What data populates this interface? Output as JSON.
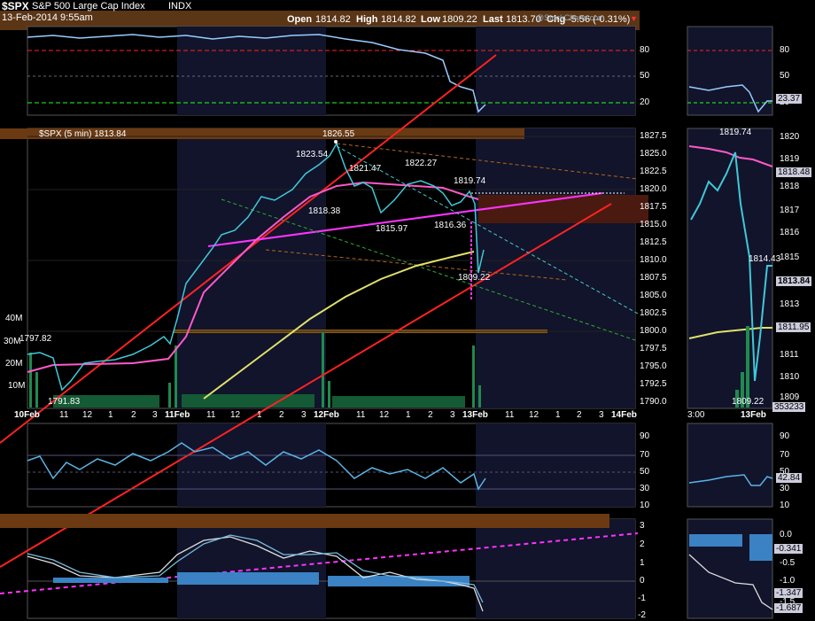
{
  "colors": {
    "bg": "#000000",
    "price": "#40c8d8",
    "ema_fast": "#ff59c7",
    "ema_slow": "#e1e16a",
    "trend": "#ff1c1c",
    "band": "#6b3a12",
    "volume": "#1f8a4f"
  },
  "header": {
    "symbol": "$SPX",
    "name": "S&P 500 Large Cap Index",
    "exchange": "INDX",
    "date": "13-Feb-2014 9:55am",
    "open_label": "Open",
    "open": "1814.82",
    "high_label": "High",
    "high": "1814.82",
    "low_label": "Low",
    "low": "1809.22",
    "last_label": "Last",
    "last": "1813.70",
    "chg_label": "Chg",
    "chg": "-5.56 (-0.31%)",
    "watermark": "@StockCharts.com"
  },
  "rsi_top": {
    "ticks": [
      "80",
      "50",
      "20"
    ]
  },
  "price_panel": {
    "legend": "$SPX (5 min) 1813.84",
    "ticks": [
      "1827.5",
      "1825.0",
      "1822.5",
      "1820.0",
      "1817.5",
      "1815.0",
      "1812.5",
      "1810.0",
      "1807.5",
      "1805.0",
      "1802.5",
      "1800.0",
      "1797.5",
      "1795.0",
      "1792.5",
      "1790.0"
    ],
    "annotations": [
      "1826.55",
      "1823.54",
      "1821.47",
      "1822.27",
      "1819.74",
      "1818.38",
      "1815.97",
      "1816.36",
      "1809.22",
      "1797.82",
      "1791.83"
    ],
    "vol_labels": [
      "40M",
      "30M",
      "20M",
      "10M"
    ]
  },
  "x_axis": {
    "labels": [
      "10Feb",
      "11",
      "12",
      "1",
      "2",
      "3",
      "11Feb",
      "11",
      "12",
      "1",
      "2",
      "3",
      "12Feb",
      "11",
      "12",
      "1",
      "2",
      "3",
      "13Feb",
      "11",
      "12",
      "1",
      "2",
      "3",
      "14Feb"
    ]
  },
  "rsi_panel": {
    "ticks": [
      "90",
      "70",
      "50",
      "30",
      "10"
    ]
  },
  "macd_panel": {
    "ticks": [
      "3",
      "2",
      "1",
      "0",
      "-1",
      "-2"
    ]
  },
  "right": {
    "rsi_ticks": [
      "80",
      "50",
      "20"
    ],
    "rsi_value": "23.37",
    "price_ticks": [
      "1820",
      "1819",
      "1818",
      "1817",
      "1816",
      "1815",
      "1814",
      "1813",
      "1812",
      "1811",
      "1810",
      "1809"
    ],
    "price_labels": {
      "high": "1819.74",
      "ema": "1818.48",
      "peak": "1814.43",
      "last": "1813.84",
      "ema2": "1811.95",
      "low": "1809.22",
      "vol": "353233"
    },
    "x_labels": [
      "3:00",
      "13Feb"
    ],
    "rsi2_ticks": [
      "90",
      "70",
      "50",
      "30",
      "10"
    ],
    "rsi2_value": "42.84",
    "macd_ticks": [
      "0.0",
      "-0.5",
      "-1.0",
      "-1.5"
    ],
    "macd_values": [
      "-0.341",
      "-1.347",
      "-1.687"
    ]
  },
  "chart_data": {
    "type": "line",
    "title": "$SPX S&P 500 Large Cap Index INDX",
    "x": [
      "10Feb",
      "11Feb",
      "12Feb",
      "13Feb"
    ],
    "series": [
      {
        "name": "$SPX (5 min)",
        "values": [
          1797.82,
          1791.83,
          1798.0,
          1810.0,
          1818.38,
          1826.55,
          1815.97,
          1822.27,
          1816.36,
          1819.74,
          1809.22,
          1813.84
        ]
      }
    ],
    "ylim": [
      1790,
      1828
    ]
  }
}
